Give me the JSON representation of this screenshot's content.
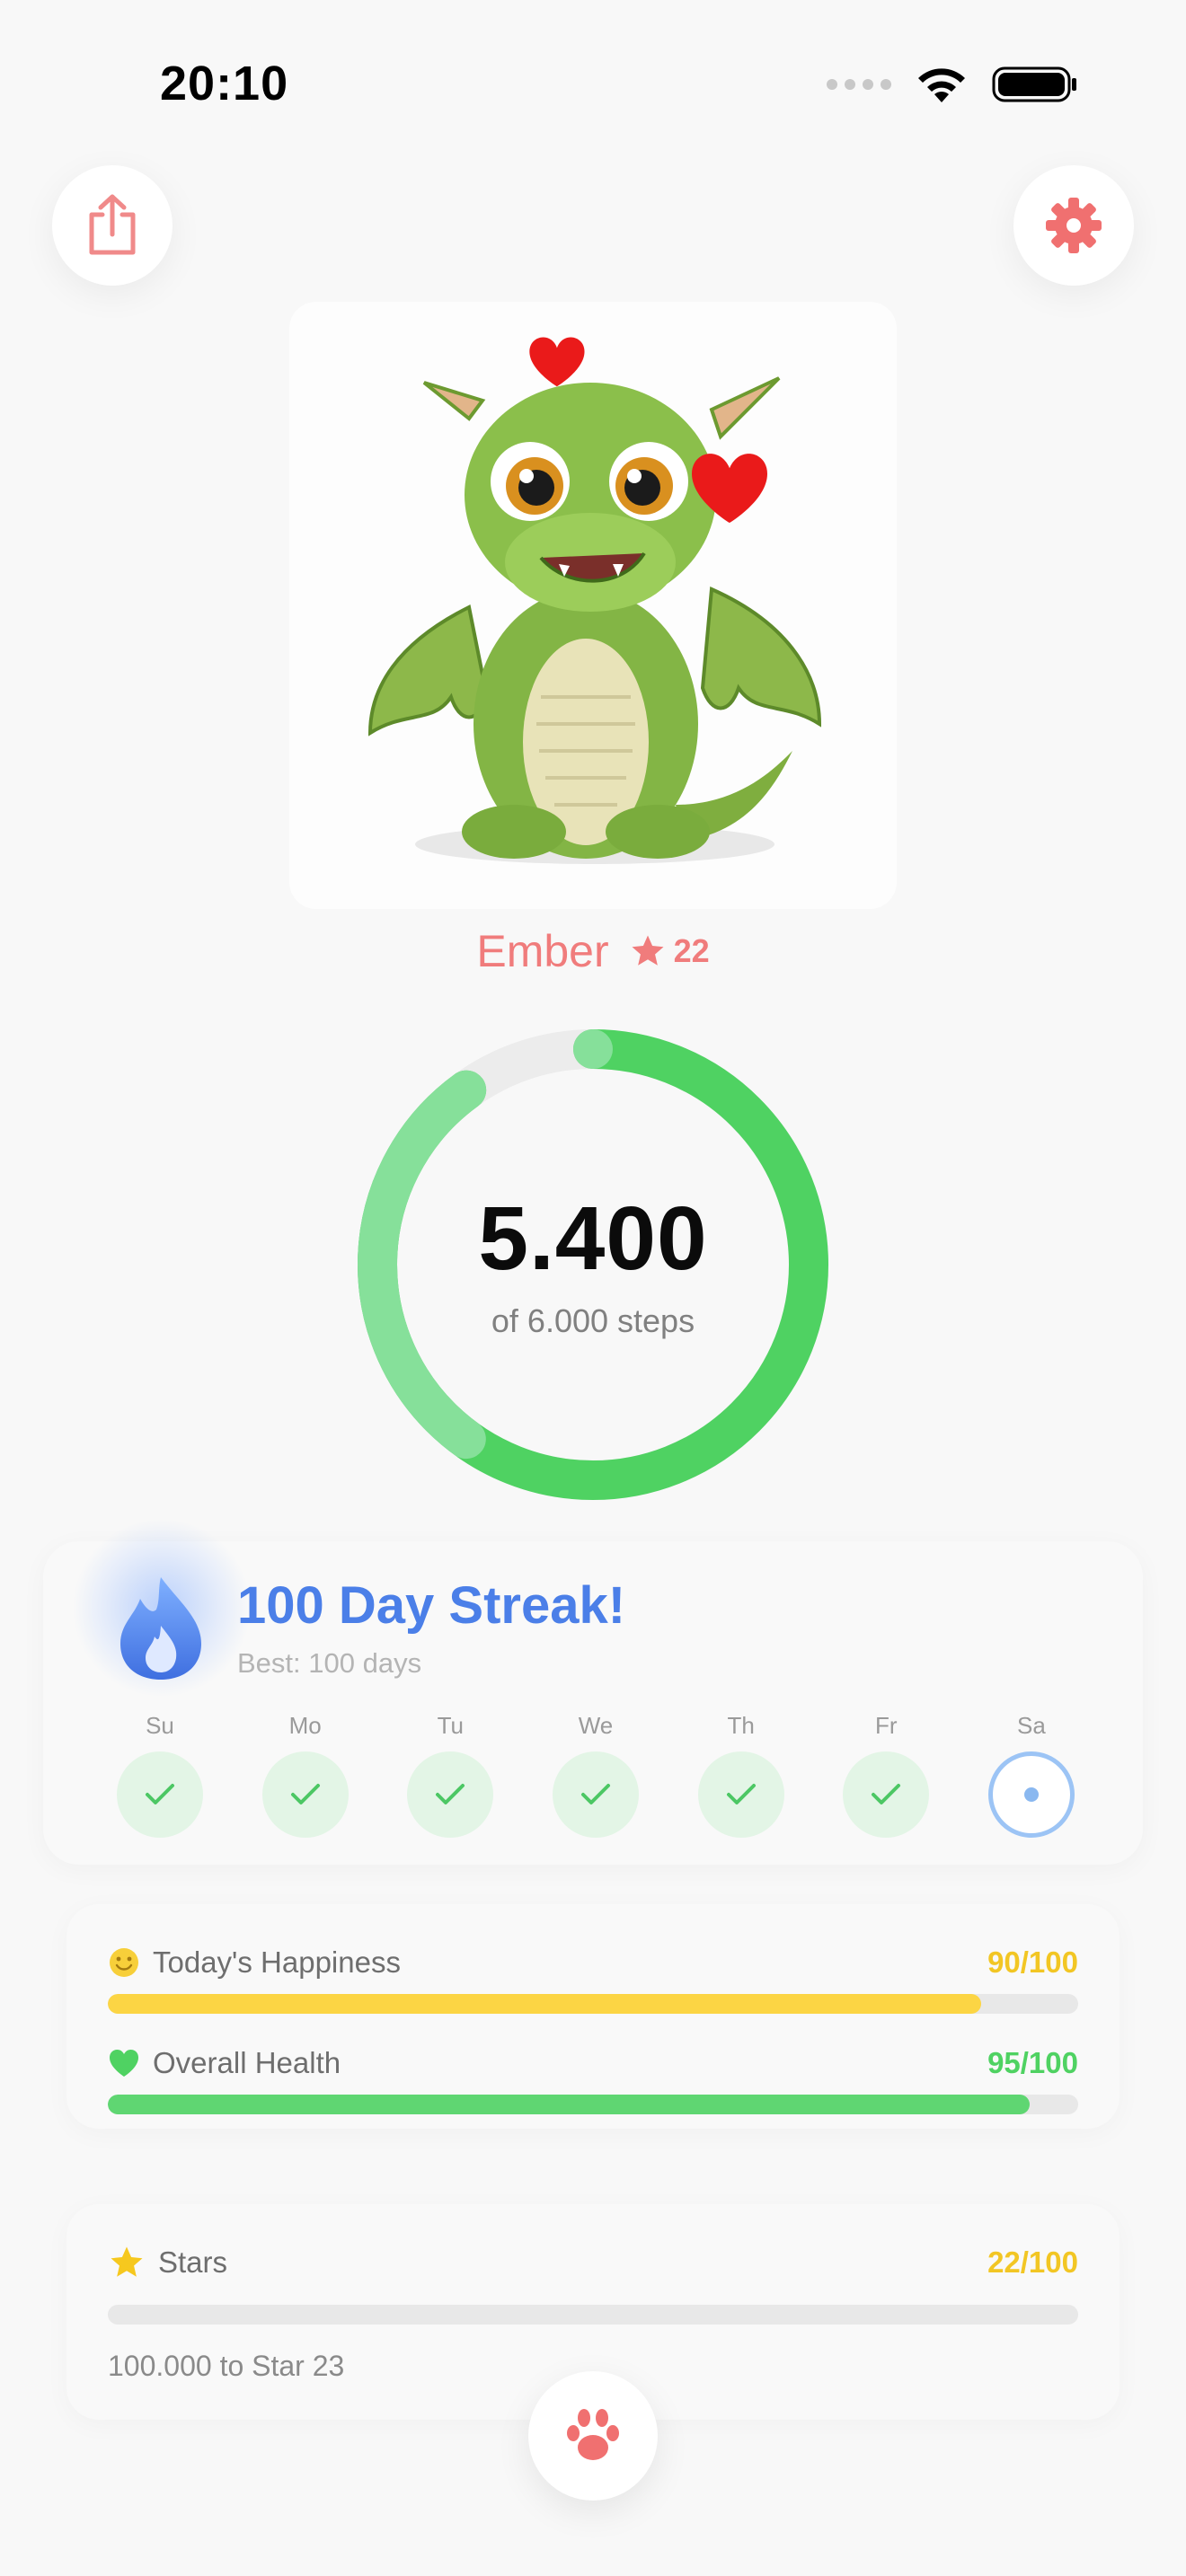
{
  "status_bar": {
    "time": "20:10"
  },
  "top_buttons": {
    "share_icon": "share-icon",
    "settings_icon": "gear-icon"
  },
  "pet": {
    "name": "Ember",
    "level": "22",
    "emoji": "dragon-with-hearts"
  },
  "steps": {
    "value": "5.400",
    "subtitle": "of 6.000 steps",
    "progress": 0.9
  },
  "streak": {
    "title": "100 Day Streak!",
    "best": "Best: 100 days",
    "days": [
      {
        "label": "Su",
        "done": true
      },
      {
        "label": "Mo",
        "done": true
      },
      {
        "label": "Tu",
        "done": true
      },
      {
        "label": "We",
        "done": true
      },
      {
        "label": "Th",
        "done": true
      },
      {
        "label": "Fr",
        "done": true
      },
      {
        "label": "Sa",
        "done": false
      }
    ]
  },
  "stats": {
    "happiness": {
      "label": "Today's Happiness",
      "value": "90/100",
      "progress": 0.9,
      "color": "#fcd544"
    },
    "health": {
      "label": "Overall Health",
      "value": "95/100",
      "progress": 0.95,
      "color": "#5fd672"
    }
  },
  "stars": {
    "label": "Stars",
    "value": "22/100",
    "note": "100.000 to Star 23",
    "progress": 0.0,
    "color": "#f6c81e"
  },
  "colors": {
    "accent": "#f07c7c",
    "streak_blue": "#4b7fe8",
    "ring_green": "#4fd262",
    "ring_light": "#86e09a"
  }
}
